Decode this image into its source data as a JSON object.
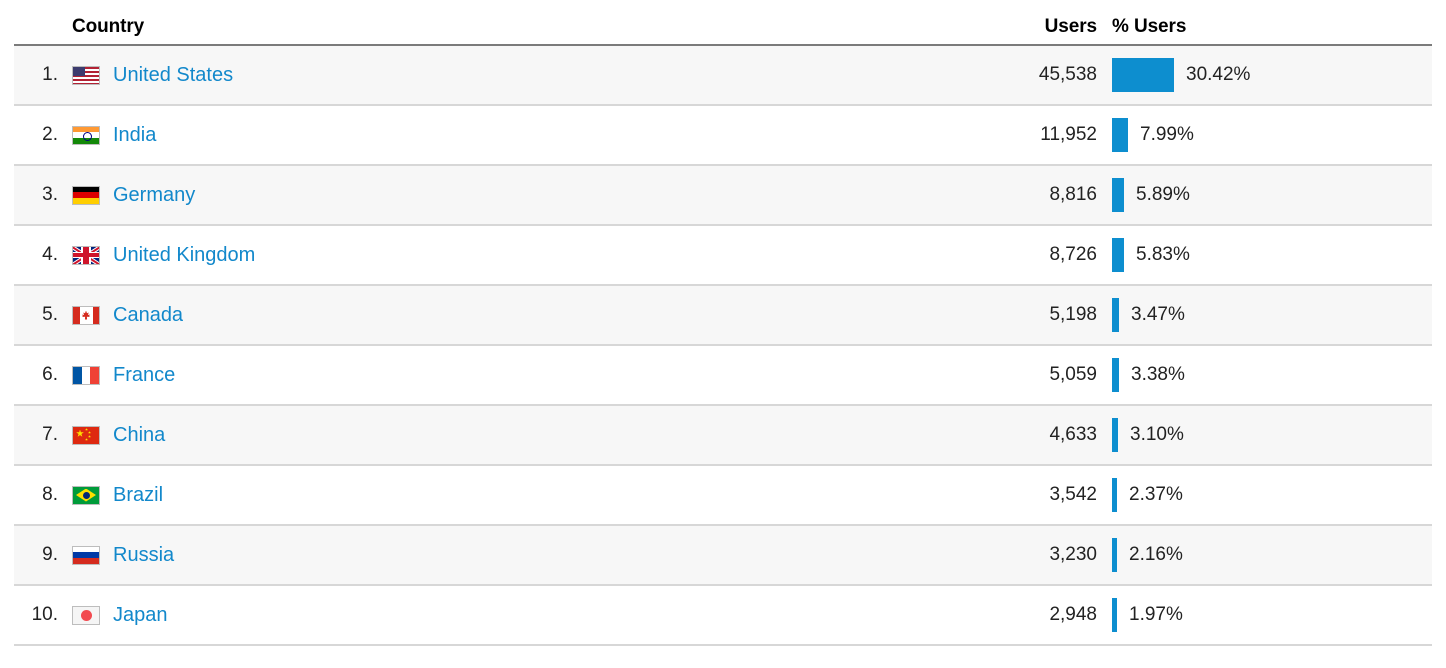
{
  "table": {
    "headers": {
      "rank": "",
      "country": "Country",
      "users": "Users",
      "percent_users": "% Users"
    },
    "accent_color": "#0d8ecf",
    "link_color": "#1288cb",
    "rows": [
      {
        "rank": "1.",
        "flag": "flag-us",
        "flag_name": "flag-united-states",
        "country": "United States",
        "users": "45,538",
        "percent": "30.42%",
        "percent_value": 30.42
      },
      {
        "rank": "2.",
        "flag": "flag-in",
        "flag_name": "flag-india",
        "country": "India",
        "users": "11,952",
        "percent": "7.99%",
        "percent_value": 7.99
      },
      {
        "rank": "3.",
        "flag": "flag-de",
        "flag_name": "flag-germany",
        "country": "Germany",
        "users": "8,816",
        "percent": "5.89%",
        "percent_value": 5.89
      },
      {
        "rank": "4.",
        "flag": "flag-gb",
        "flag_name": "flag-united-kingdom",
        "country": "United Kingdom",
        "users": "8,726",
        "percent": "5.83%",
        "percent_value": 5.83
      },
      {
        "rank": "5.",
        "flag": "flag-ca",
        "flag_name": "flag-canada",
        "country": "Canada",
        "users": "5,198",
        "percent": "3.47%",
        "percent_value": 3.47
      },
      {
        "rank": "6.",
        "flag": "flag-fr",
        "flag_name": "flag-france",
        "country": "France",
        "users": "5,059",
        "percent": "3.38%",
        "percent_value": 3.38
      },
      {
        "rank": "7.",
        "flag": "flag-cn",
        "flag_name": "flag-china",
        "country": "China",
        "users": "4,633",
        "percent": "3.10%",
        "percent_value": 3.1
      },
      {
        "rank": "8.",
        "flag": "flag-br",
        "flag_name": "flag-brazil",
        "country": "Brazil",
        "users": "3,542",
        "percent": "2.37%",
        "percent_value": 2.37
      },
      {
        "rank": "9.",
        "flag": "flag-ru",
        "flag_name": "flag-russia",
        "country": "Russia",
        "users": "3,230",
        "percent": "2.16%",
        "percent_value": 2.16
      },
      {
        "rank": "10.",
        "flag": "flag-jp",
        "flag_name": "flag-japan",
        "country": "Japan",
        "users": "2,948",
        "percent": "1.97%",
        "percent_value": 1.97
      }
    ]
  },
  "chart_data": {
    "type": "table",
    "title": "",
    "columns": [
      "Country",
      "Users",
      "% Users"
    ],
    "categories": [
      "United States",
      "India",
      "Germany",
      "United Kingdom",
      "Canada",
      "France",
      "China",
      "Brazil",
      "Russia",
      "Japan"
    ],
    "series": [
      {
        "name": "Users",
        "values": [
          45538,
          11952,
          8816,
          8726,
          5198,
          5059,
          4633,
          3542,
          3230,
          2948
        ]
      },
      {
        "name": "% Users",
        "values": [
          30.42,
          7.99,
          5.89,
          5.83,
          3.47,
          3.38,
          3.1,
          2.37,
          2.16,
          1.97
        ]
      }
    ],
    "bar_max_percent": 30.42,
    "legend": "none",
    "grid": false
  }
}
